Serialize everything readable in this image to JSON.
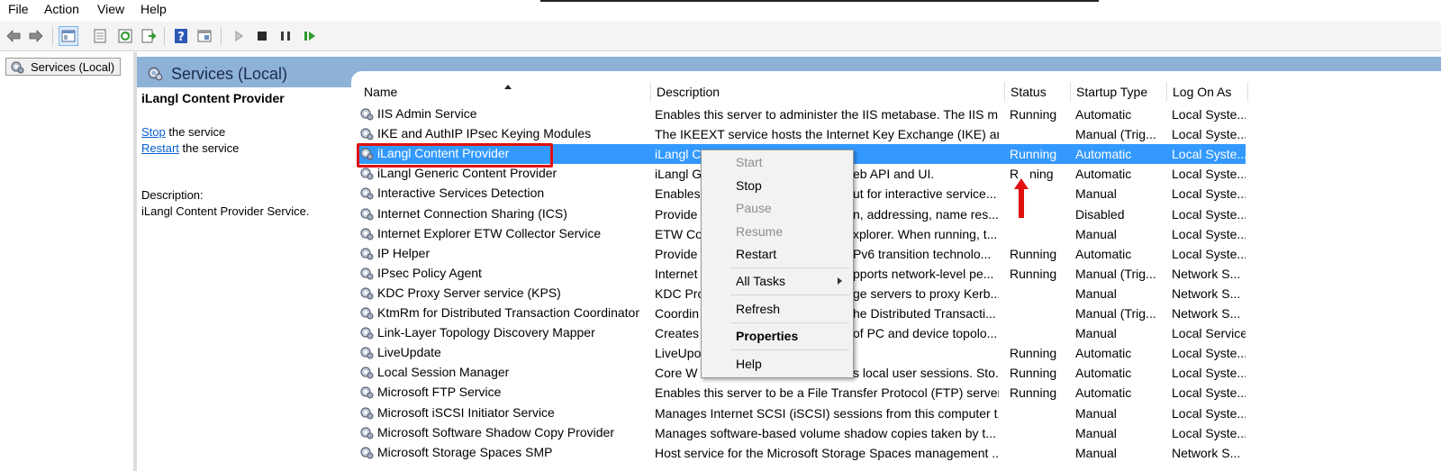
{
  "menu": [
    "File",
    "Action",
    "View",
    "Help"
  ],
  "toolbar_icons": [
    "back-icon",
    "forward-icon",
    "console-tree-icon",
    "properties-icon",
    "refresh-icon",
    "export-list-icon",
    "help-icon",
    "mmc-view-icon",
    "play-icon",
    "stop-icon",
    "pause-icon",
    "resume-icon"
  ],
  "tree": {
    "root_label": "Services (Local)"
  },
  "header": {
    "title": "Services (Local)"
  },
  "details": {
    "service_name": "iLangl Content Provider",
    "stop_link": "Stop",
    "stop_suffix": " the service",
    "restart_link": "Restart",
    "restart_suffix": " the service",
    "description_label": "Description:",
    "description_text": "iLangl Content Provider Service."
  },
  "columns": [
    "Name",
    "Description",
    "Status",
    "Startup Type",
    "Log On As"
  ],
  "rows": [
    {
      "name": "IIS Admin Service",
      "description": "Enables this server to administer the IIS metabase. The IIS m...",
      "status": "Running",
      "startup": "Automatic",
      "logon": "Local Syste..."
    },
    {
      "name": "IKE and AuthIP IPsec Keying Modules",
      "description": "The IKEEXT service hosts the Internet Key Exchange (IKE) an...",
      "status": "",
      "startup": "Manual (Trig...",
      "logon": "Local Syste..."
    },
    {
      "name": "iLangl Content Provider",
      "description": "iLangl C",
      "status": "Running",
      "startup": "Automatic",
      "logon": "Local Syste..."
    },
    {
      "name": "iLangl Generic Content Provider",
      "description": "iLangl G",
      "description_tail": "eb API and UI.",
      "status": "R",
      "status_tail": "ning",
      "startup": "Automatic",
      "logon": "Local Syste..."
    },
    {
      "name": "Interactive Services Detection",
      "description": "Enables",
      "description_tail": "ut for interactive service...",
      "status": "",
      "startup": "Manual",
      "logon": "Local Syste..."
    },
    {
      "name": "Internet Connection Sharing (ICS)",
      "description": "Provide",
      "description_tail": "n, addressing, name res...",
      "status": "",
      "startup": "Disabled",
      "logon": "Local Syste..."
    },
    {
      "name": "Internet Explorer ETW Collector Service",
      "description": "ETW Co",
      "description_tail": "xplorer. When running, t...",
      "status": "",
      "startup": "Manual",
      "logon": "Local Syste..."
    },
    {
      "name": "IP Helper",
      "description": "Provide",
      "description_tail": "Pv6 transition technolo...",
      "status": "Running",
      "startup": "Automatic",
      "logon": "Local Syste..."
    },
    {
      "name": "IPsec Policy Agent",
      "description": "Internet",
      "description_tail": "pports network-level pe...",
      "status": "Running",
      "startup": "Manual (Trig...",
      "logon": "Network S..."
    },
    {
      "name": "KDC Proxy Server service (KPS)",
      "description": "KDC Pro",
      "description_tail": "ge servers to proxy Kerb...",
      "status": "",
      "startup": "Manual",
      "logon": "Network S..."
    },
    {
      "name": "KtmRm for Distributed Transaction Coordinator",
      "description": "Coordin",
      "description_tail": "he Distributed Transacti...",
      "status": "",
      "startup": "Manual (Trig...",
      "logon": "Network S..."
    },
    {
      "name": "Link-Layer Topology Discovery Mapper",
      "description": "Creates",
      "description_tail": "of PC and device topolo...",
      "status": "",
      "startup": "Manual",
      "logon": "Local Service"
    },
    {
      "name": "LiveUpdate",
      "description": "LiveUpo",
      "description_tail": "",
      "status": "Running",
      "startup": "Automatic",
      "logon": "Local Syste..."
    },
    {
      "name": "Local Session Manager",
      "description": "Core W",
      "description_tail": "s local user sessions. Sto...",
      "status": "Running",
      "startup": "Automatic",
      "logon": "Local Syste..."
    },
    {
      "name": "Microsoft FTP Service",
      "description": "Enables this server to be a File Transfer Protocol (FTP) server...",
      "status": "Running",
      "startup": "Automatic",
      "logon": "Local Syste..."
    },
    {
      "name": "Microsoft iSCSI Initiator Service",
      "description": "Manages Internet SCSI (iSCSI) sessions from this computer t...",
      "status": "",
      "startup": "Manual",
      "logon": "Local Syste..."
    },
    {
      "name": "Microsoft Software Shadow Copy Provider",
      "description": "Manages software-based volume shadow copies taken by t...",
      "status": "",
      "startup": "Manual",
      "logon": "Local Syste..."
    },
    {
      "name": "Microsoft Storage Spaces SMP",
      "description": "Host service for the Microsoft Storage Spaces management ...",
      "status": "",
      "startup": "Manual",
      "logon": "Network S..."
    }
  ],
  "context_menu": {
    "start": "Start",
    "stop": "Stop",
    "pause": "Pause",
    "resume": "Resume",
    "restart": "Restart",
    "all_tasks": "All Tasks",
    "refresh": "Refresh",
    "properties": "Properties",
    "help": "Help"
  },
  "colors": {
    "selection": "#3399ff",
    "header_band": "#8eb1d8",
    "highlight": "#e01010",
    "link": "#0a5fd1"
  }
}
